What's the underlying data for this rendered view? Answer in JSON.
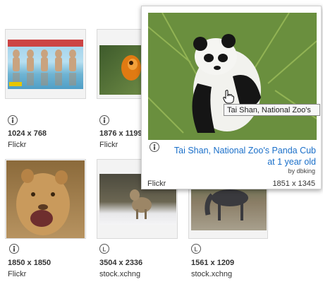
{
  "results": [
    {
      "dims": "1024 x 768",
      "source": "Flickr",
      "license": "attribution-icon"
    },
    {
      "dims": "1876 x 1199",
      "source": "Flickr",
      "license": "attribution-icon"
    },
    {
      "dims": "1850 x 1850",
      "source": "Flickr",
      "license": "attribution-icon"
    },
    {
      "dims": "3504 x 2336",
      "source": "stock.xchng",
      "license": "license-icon"
    },
    {
      "dims": "1561 x 1209",
      "source": "stock.xchng",
      "license": "license-icon"
    }
  ],
  "popup": {
    "title": "Tai Shan, National Zoo's Panda Cub at 1 year old",
    "byline": "by dbking",
    "source": "Flickr",
    "dims": "1851 x 1345",
    "license": "attribution-icon"
  },
  "tooltip": "Tai Shan, National Zoo's",
  "colors": {
    "link": "#1a6fc9",
    "border": "#d9d9d9"
  }
}
